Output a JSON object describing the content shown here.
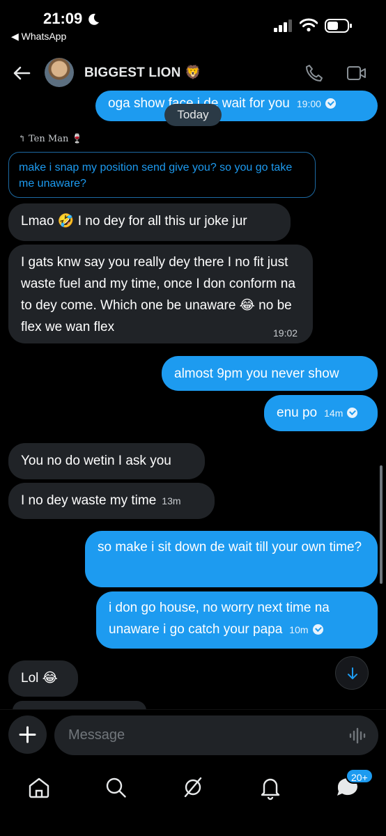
{
  "status_bar": {
    "time": "21:09",
    "back_app": "◀ WhatsApp"
  },
  "header": {
    "contact_name": "BIGGEST LION 🦁"
  },
  "date_divider": "Today",
  "reply": {
    "author": "↰ Ten Man 🍷",
    "quoted_text": "make i snap my position send give you? so you go take me unaware?"
  },
  "messages": [
    {
      "direction": "out",
      "text": "oga show face i de wait for you",
      "time": "19:00",
      "read": true
    },
    {
      "direction": "in",
      "text": "Lmao 🤣 I no dey for all this ur joke jur",
      "time": ""
    },
    {
      "direction": "in",
      "text": "I gats knw say you really dey there I no fit just waste fuel and my time, once I don conform na to dey come. Which one be unaware 😂 no be flex we wan flex",
      "time": "19:02"
    },
    {
      "direction": "out",
      "text": "almost 9pm you never show",
      "time": ""
    },
    {
      "direction": "out",
      "text": "enu po",
      "time": "14m",
      "read": true
    },
    {
      "direction": "in",
      "text": "You no do wetin I ask you",
      "time": ""
    },
    {
      "direction": "in",
      "text": "I no dey waste my time",
      "time": "13m"
    },
    {
      "direction": "out",
      "text": "so make i sit down de wait till your own time?",
      "time": ""
    },
    {
      "direction": "out",
      "text": "i don go house, no worry next time na unaware i go catch your papa",
      "time": "10m",
      "read": true
    },
    {
      "direction": "in",
      "text": "Lol 😂",
      "time": ""
    }
  ],
  "composer": {
    "placeholder": "Message"
  },
  "nav": {
    "badge": "20+"
  },
  "colors": {
    "accent": "#1d9bf0",
    "incoming_bubble": "#202327",
    "background": "#000000"
  }
}
